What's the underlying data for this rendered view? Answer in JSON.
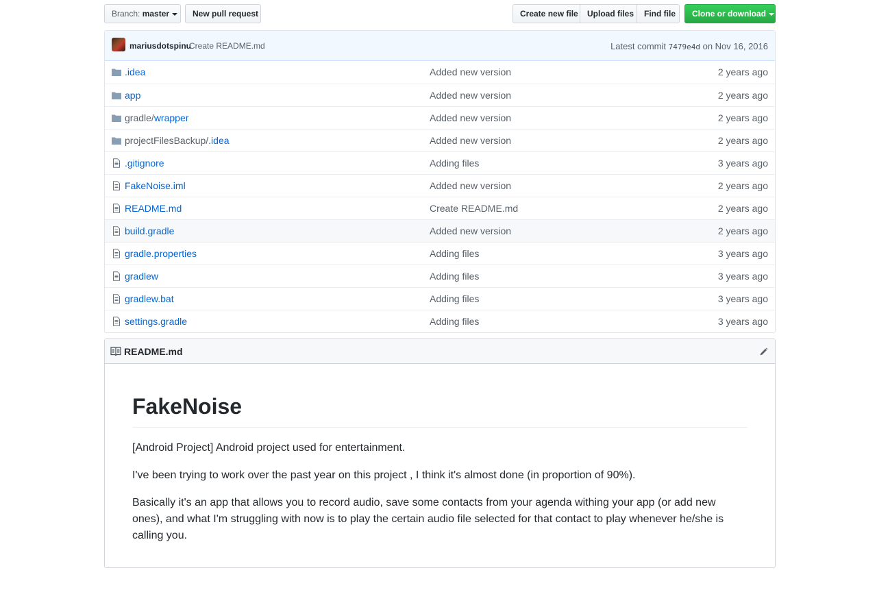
{
  "toolbar": {
    "branch_prefix": "Branch:",
    "branch_name": "master",
    "new_pr": "New pull request",
    "create_file": "Create new file",
    "upload_files": "Upload files",
    "find_file": "Find file",
    "clone": "Clone or download"
  },
  "commit": {
    "author": "mariusdotspinu",
    "message": "Create README.md",
    "latest_label": "Latest commit",
    "sha": "7479e4d",
    "date": "on Nov 16, 2016"
  },
  "files": [
    {
      "prefix": "",
      "name": ".idea",
      "type": "folder",
      "message": "Added new version",
      "age": "2 years ago"
    },
    {
      "prefix": "",
      "name": "app",
      "type": "folder",
      "message": "Added new version",
      "age": "2 years ago"
    },
    {
      "prefix": "gradle/",
      "name": "wrapper",
      "type": "folder",
      "message": "Added new version",
      "age": "2 years ago"
    },
    {
      "prefix": "projectFilesBackup/",
      "name": ".idea",
      "type": "folder",
      "message": "Added new version",
      "age": "2 years ago"
    },
    {
      "prefix": "",
      "name": ".gitignore",
      "type": "file",
      "message": "Adding files",
      "age": "3 years ago"
    },
    {
      "prefix": "",
      "name": "FakeNoise.iml",
      "type": "file",
      "message": "Added new version",
      "age": "2 years ago"
    },
    {
      "prefix": "",
      "name": "README.md",
      "type": "file",
      "message": "Create README.md",
      "age": "2 years ago"
    },
    {
      "prefix": "",
      "name": "build.gradle",
      "type": "file",
      "message": "Added new version",
      "age": "2 years ago"
    },
    {
      "prefix": "",
      "name": "gradle.properties",
      "type": "file",
      "message": "Adding files",
      "age": "3 years ago"
    },
    {
      "prefix": "",
      "name": "gradlew",
      "type": "file",
      "message": "Adding files",
      "age": "3 years ago"
    },
    {
      "prefix": "",
      "name": "gradlew.bat",
      "type": "file",
      "message": "Adding files",
      "age": "3 years ago"
    },
    {
      "prefix": "",
      "name": "settings.gradle",
      "type": "file",
      "message": "Adding files",
      "age": "3 years ago"
    }
  ],
  "readme": {
    "filename": "README.md",
    "heading": "FakeNoise",
    "paragraphs": [
      "[Android Project] Android project used for entertainment.",
      "I've been trying to work over the past year on this project , I think it's almost done (in proportion of 90%).",
      "Basically it's an app that allows you to record audio, save some contacts from your agenda withing your app (or add new ones), and what I'm struggling with now is to play the certain audio file selected for that contact to play whenever he/she is calling you."
    ]
  },
  "colors": {
    "link": "#0366d6",
    "muted": "#586069",
    "green": "#28a745",
    "commit_bg": "#f1f8ff"
  }
}
